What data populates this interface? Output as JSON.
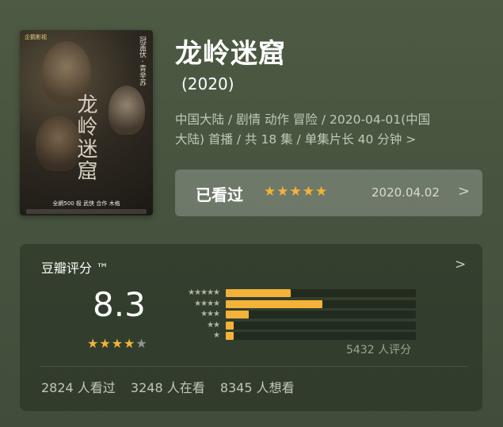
{
  "movie": {
    "title": "龙岭迷窟",
    "year": "(2020)",
    "meta_line1": "中国大陆 / 剧情 动作 冒险 / 2020-04-01(中国",
    "meta_line2": "大陆) 首播 / 共 18 集 / 单集片长 40 分钟",
    "meta_chevron": ">"
  },
  "poster": {
    "calligraphy": "龙岭迷窟",
    "top_text": "冠盖伏 · 青辛苏",
    "logo": "企鹅影视",
    "bottom_text": "全網500 极 武侠 合作 木格"
  },
  "watched": {
    "label": "已看过",
    "stars": "★★★★★",
    "rating": 5,
    "date": "2020.04.02",
    "chevron": ">"
  },
  "rating_card": {
    "header": "豆瓣评分 ™",
    "chevron": ">",
    "score": "8.3",
    "stars_on": "★★★★",
    "stars_off": "★",
    "star_rating": 4,
    "distribution": [
      {
        "stars": "★★★★★",
        "fraction": 0.34
      },
      {
        "stars": "★★★★",
        "fraction": 0.51
      },
      {
        "stars": "★★★",
        "fraction": 0.12
      },
      {
        "stars": "★★",
        "fraction": 0.04
      },
      {
        "stars": "★",
        "fraction": 0.04
      }
    ],
    "count": "5432 人评分",
    "stats": [
      "2824 人看过",
      "3248 人在看",
      "8345 人想看"
    ]
  },
  "colors": {
    "accent_star": "#f3b239",
    "background": "#4a5741"
  }
}
